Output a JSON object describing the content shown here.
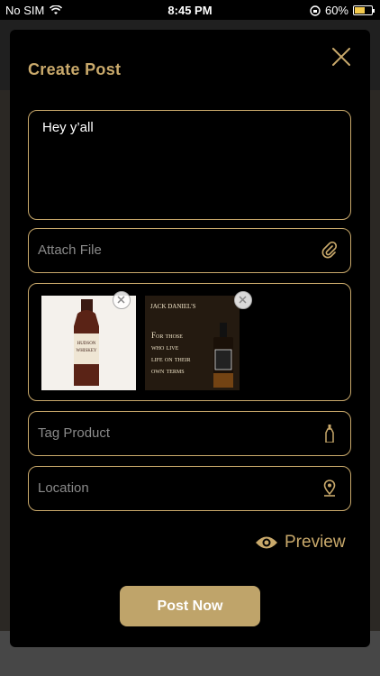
{
  "status_bar": {
    "carrier": "No SIM",
    "time": "8:45 PM",
    "battery_percent": "60%",
    "battery_level": 0.6
  },
  "modal": {
    "title": "Create Post",
    "message_value": "Hey y’all",
    "attach_placeholder": "Attach File",
    "tag_placeholder": "Tag Product",
    "location_placeholder": "Location",
    "preview_label": "Preview",
    "post_button_label": "Post Now"
  },
  "media": [
    {
      "label_line1": "HUDSON",
      "label_line2": "WHISKEY"
    },
    {
      "brand": "JACK DANIEL'S",
      "tagline_lines": [
        "For those",
        "who live",
        "life on their",
        "own terms"
      ]
    }
  ],
  "colors": {
    "accent": "#c9a96b",
    "button": "#bfa46a",
    "modal_bg": "#000000"
  }
}
